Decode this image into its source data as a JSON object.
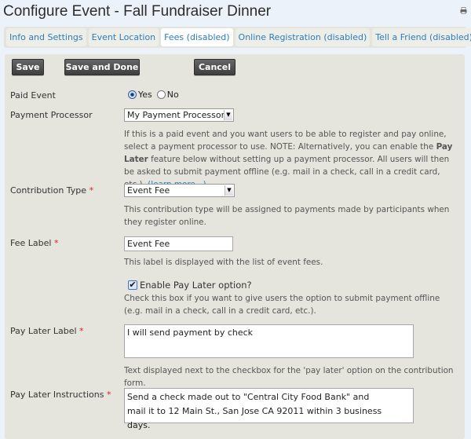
{
  "header": {
    "title": "Configure Event - Fall Fundraiser Dinner",
    "print_icon": "printer-icon"
  },
  "tabs": [
    {
      "label": "Info and Settings",
      "active": false
    },
    {
      "label": "Event Location",
      "active": false
    },
    {
      "label": "Fees (disabled)",
      "active": true
    },
    {
      "label": "Online Registration (disabled)",
      "active": false
    },
    {
      "label": "Tell a Friend (disabled)",
      "active": false
    }
  ],
  "toolbar": {
    "save_label": "Save",
    "save_done_label": "Save and Done",
    "cancel_label": "Cancel"
  },
  "form": {
    "paid_event": {
      "label": "Paid Event",
      "options": [
        "Yes",
        "No"
      ],
      "selected": "Yes"
    },
    "payment_processor": {
      "label": "Payment Processor",
      "value": "My Payment Processor",
      "help_part1": "If this is a paid event and you want users to be able to register and pay online, select a payment processor to use. NOTE: Alternatively, you can enable the ",
      "help_bold": "Pay Later",
      "help_part2": " feature below without setting up a payment processor. All users will then be asked to submit payment offline (e.g. mail in a check, call in a credit card, etc.). ",
      "help_link": "(learn more...)"
    },
    "contribution_type": {
      "label": "Contribution Type",
      "required": "*",
      "value": "Event Fee",
      "help": "This contribution type will be assigned to payments made by participants when they register online."
    },
    "fee_label": {
      "label": "Fee Label",
      "required": "*",
      "value": "Event Fee",
      "help": "This label is displayed with the list of event fees."
    },
    "pay_later_option": {
      "label": "Enable Pay Later option?",
      "checked": true,
      "help": "Check this box if you want to give users the option to submit payment offline (e.g. mail in a check, call in a credit card, etc.)."
    },
    "pay_later_label": {
      "label": "Pay Later Label",
      "required": "*",
      "value": "I will send payment by check",
      "help": "Text displayed next to the checkbox for the 'pay later' option on the contribution form."
    },
    "pay_later_instructions": {
      "label": "Pay Later Instructions",
      "required": "*",
      "value": "Send a check made out to \"Central City Food Bank\" and mail it to 12 Main St., San Jose CA 92011 within 3 business days."
    }
  }
}
